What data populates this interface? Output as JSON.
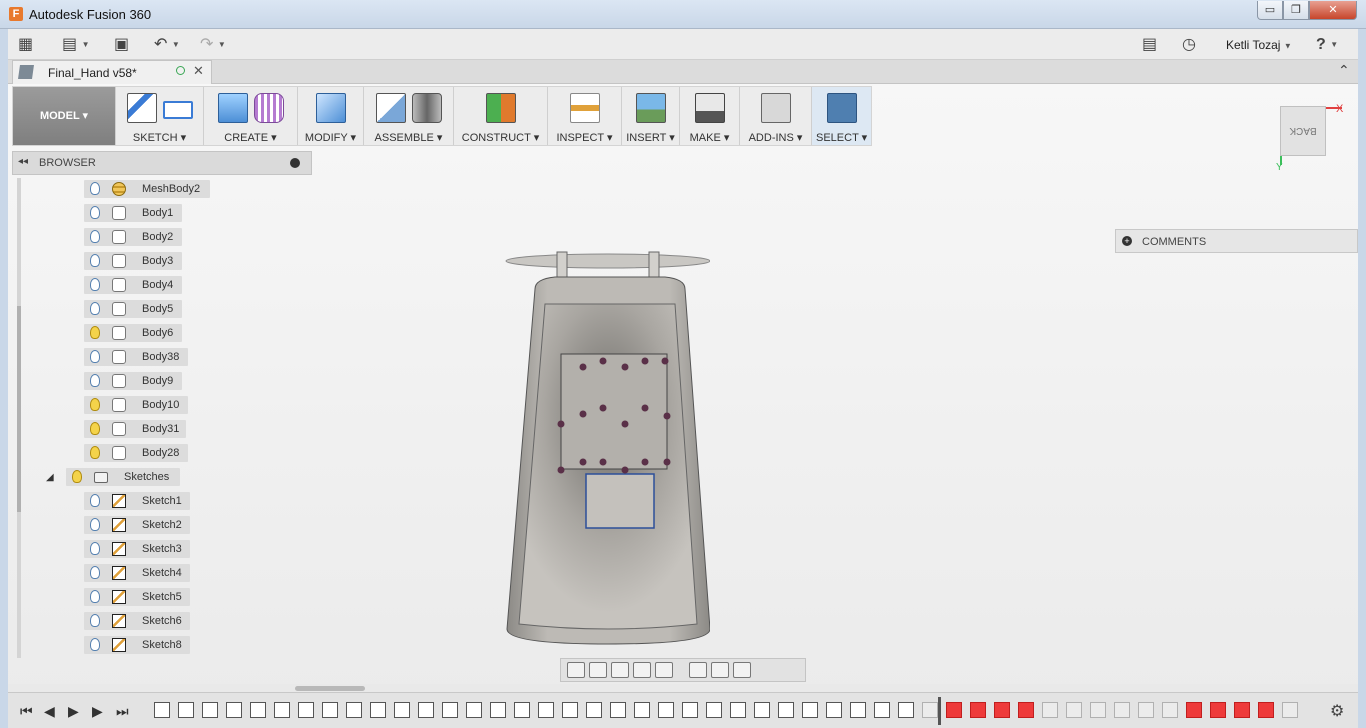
{
  "window": {
    "title": "Autodesk Fusion 360",
    "logo_letter": "F",
    "min_glyph": "▭",
    "max_glyph": "❐",
    "close_glyph": "✕"
  },
  "appbar": {
    "user": "Ketli Tozaj",
    "grid_glyph": "▦",
    "file_glyph": "▤",
    "save_glyph": "▣",
    "undo_glyph": "↶",
    "redo_glyph": "↷",
    "chat_glyph": "▤",
    "history_glyph": "◷",
    "help_glyph": "?",
    "caret": "▼"
  },
  "document": {
    "name": "Final_Hand v58*",
    "close_glyph": "✕",
    "collapse_glyph": "⌃"
  },
  "toolbar": {
    "workspace": "MODEL ▾",
    "groups": [
      {
        "label": "SKETCH ▾"
      },
      {
        "label": "CREATE ▾"
      },
      {
        "label": "MODIFY ▾"
      },
      {
        "label": "ASSEMBLE ▾"
      },
      {
        "label": "CONSTRUCT ▾"
      },
      {
        "label": "INSPECT ▾"
      },
      {
        "label": "INSERT ▾"
      },
      {
        "label": "MAKE ▾"
      },
      {
        "label": "ADD-INS ▾"
      },
      {
        "label": "SELECT ▾"
      }
    ]
  },
  "viewcube": {
    "face": "BACK",
    "x_label": "X",
    "y_label": "Y"
  },
  "browser": {
    "title": "BROWSER",
    "collapse_glyph": "◂◂",
    "bodies": [
      {
        "label": "MeshBody2",
        "light_on": false,
        "mesh": true
      },
      {
        "label": "Body1",
        "light_on": false
      },
      {
        "label": "Body2",
        "light_on": false
      },
      {
        "label": "Body3",
        "light_on": false
      },
      {
        "label": "Body4",
        "light_on": false
      },
      {
        "label": "Body5",
        "light_on": false
      },
      {
        "label": "Body6",
        "light_on": true
      },
      {
        "label": "Body38",
        "light_on": false
      },
      {
        "label": "Body9",
        "light_on": false
      },
      {
        "label": "Body10",
        "light_on": true
      },
      {
        "label": "Body31",
        "light_on": true
      },
      {
        "label": "Body28",
        "light_on": true
      }
    ],
    "sketches_folder": {
      "label": "Sketches",
      "toggle_glyph": "◢"
    },
    "sketches": [
      {
        "label": "Sketch1"
      },
      {
        "label": "Sketch2"
      },
      {
        "label": "Sketch3"
      },
      {
        "label": "Sketch4"
      },
      {
        "label": "Sketch5"
      },
      {
        "label": "Sketch6"
      },
      {
        "label": "Sketch8"
      }
    ]
  },
  "comments": {
    "label": "COMMENTS",
    "plus_glyph": "+"
  },
  "timeline": {
    "first": "⏮",
    "prev": "◀",
    "play": "▶",
    "next": "▶",
    "last": "⏭",
    "gear": "⚙"
  }
}
